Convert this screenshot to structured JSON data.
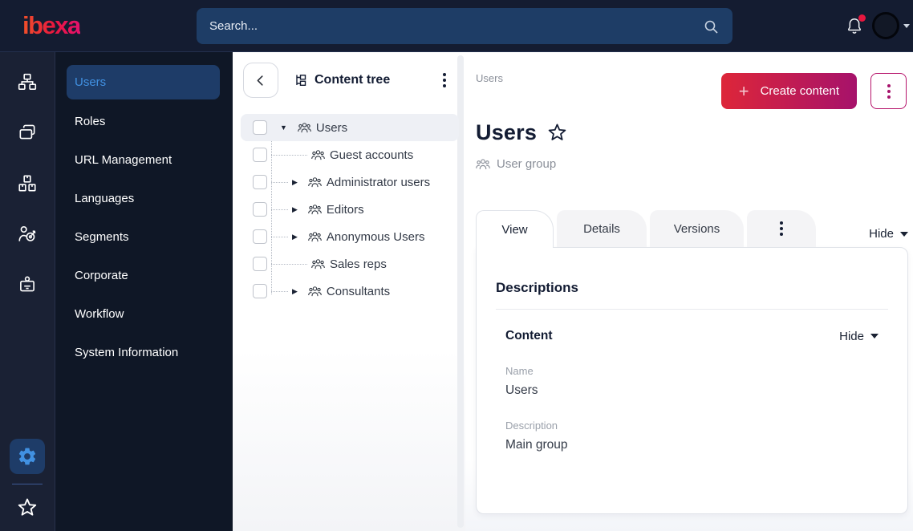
{
  "topbar": {
    "logo": "ibexa",
    "search_placeholder": "Search...",
    "icons": [
      "search-icon",
      "bell-icon",
      "notification-dot",
      "avatar",
      "caret-down"
    ]
  },
  "rail": {
    "icons": [
      "sitemap-icon",
      "pages-icon",
      "products-icon",
      "audience-icon",
      "badge-icon"
    ],
    "bottom_icons": [
      "settings-gear-icon",
      "bookmark-star-icon"
    ]
  },
  "sidebar": {
    "items": [
      {
        "label": "Users",
        "active": true
      },
      {
        "label": "Roles",
        "active": false
      },
      {
        "label": "URL Management",
        "active": false
      },
      {
        "label": "Languages",
        "active": false
      },
      {
        "label": "Segments",
        "active": false
      },
      {
        "label": "Corporate",
        "active": false
      },
      {
        "label": "Workflow",
        "active": false
      },
      {
        "label": "System Information",
        "active": false
      }
    ]
  },
  "tree": {
    "title": "Content tree",
    "items": [
      {
        "label": "Users",
        "state": "expanded",
        "selected": true,
        "checked": false
      },
      {
        "label": "Guest accounts",
        "state": "leaf",
        "selected": false,
        "checked": false
      },
      {
        "label": "Administrator users",
        "state": "collapsed",
        "selected": false,
        "checked": false
      },
      {
        "label": "Editors",
        "state": "collapsed",
        "selected": false,
        "checked": false
      },
      {
        "label": "Anonymous Users",
        "state": "collapsed",
        "selected": false,
        "checked": false
      },
      {
        "label": "Sales reps",
        "state": "leaf",
        "selected": false,
        "checked": false
      },
      {
        "label": "Consultants",
        "state": "collapsed",
        "selected": false,
        "checked": false
      }
    ]
  },
  "main": {
    "breadcrumb": "Users",
    "create_button": "Create content",
    "title": "Users",
    "content_type": "User group",
    "tabs": [
      "View",
      "Details",
      "Versions"
    ],
    "hide_toggle": "Hide",
    "card": {
      "section_title": "Descriptions",
      "group_title": "Content",
      "group_hide": "Hide",
      "fields": [
        {
          "label": "Name",
          "value": "Users"
        },
        {
          "label": "Description",
          "value": "Main group"
        }
      ]
    }
  },
  "icons": {
    "caret_down": "▼",
    "caret_right": "▶",
    "plus": "+"
  },
  "colors": {
    "topbar_bg": "#141c31",
    "rail_bg": "#1a2134",
    "menu_bg": "#0f1726",
    "search_bg": "#1e3d66",
    "active_item_bg": "#1e3c68",
    "active_item_text": "#4191e2",
    "accent_red": "#dd2639",
    "accent_magenta": "#a6126b",
    "notification_red": "#e8173f",
    "tree_selected_bg": "#eef0f5"
  }
}
